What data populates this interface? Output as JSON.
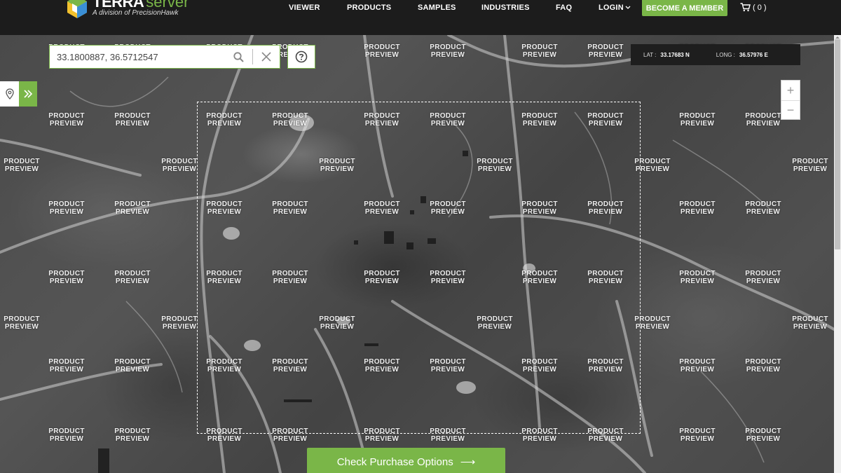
{
  "brand": {
    "name_bold": "TERRA",
    "name_light": "server",
    "tagline": "A division of PrecisionHawk",
    "accent": "#7ab648"
  },
  "nav": {
    "items": [
      "VIEWER",
      "PRODUCTS",
      "SAMPLES",
      "INDUSTRIES",
      "FAQ"
    ],
    "login": "LOGIN",
    "member_button": "BECOME A MEMBER",
    "cart_count": "( 0 )"
  },
  "search": {
    "value": "33.1800887, 36.5712547",
    "placeholder": "",
    "search_icon": "search-icon",
    "clear_icon": "close-icon",
    "help_icon": "question-icon"
  },
  "coords": {
    "lat_label": "LAT :",
    "lat_value": "33.17683 N",
    "long_label": "LONG :",
    "long_value": "36.57976 E"
  },
  "zoom": {
    "in": "+",
    "out": "−"
  },
  "watermark": {
    "line1": "PRODUCT",
    "line2": "PREVIEW"
  },
  "purchase": {
    "label": "Check Purchase Options",
    "arrow": "⟶"
  }
}
